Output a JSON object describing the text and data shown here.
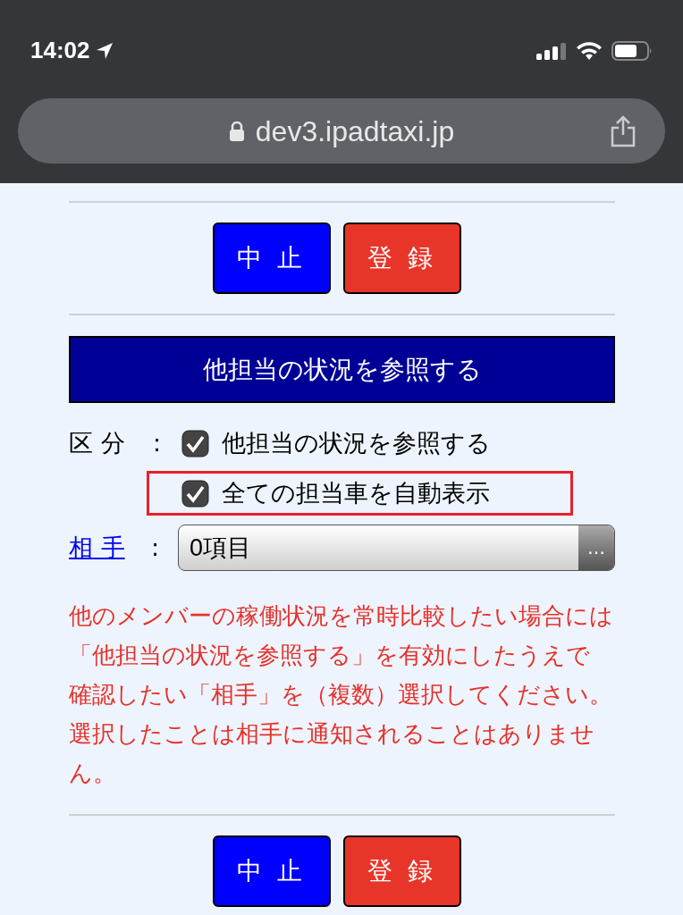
{
  "status_bar": {
    "time": "14:02"
  },
  "browser": {
    "url": "dev3.ipadtaxi.jp"
  },
  "top_buttons": [
    {
      "kind": "cancel",
      "label": "中 止"
    },
    {
      "kind": "register",
      "label": "登 録"
    }
  ],
  "section": {
    "title": "他担当の状況を参照する"
  },
  "category": {
    "label": "区 分",
    "colon": ":",
    "options": [
      {
        "label": "他担当の状況を参照する",
        "checked": true,
        "highlighted": false
      },
      {
        "label": "全ての担当車を自動表示",
        "checked": true,
        "highlighted": true
      }
    ]
  },
  "partner": {
    "label": "相 手",
    "colon": ":",
    "value": "0項目",
    "button": "…"
  },
  "notice": [
    "他のメンバーの稼働状況を常時比較したい場合には",
    "「他担当の状況を参照する」を有効にしたうえで",
    "確認したい「相手」を（複数）選択してください。",
    "選択したことは相手に通知されることはありませ",
    "ん。"
  ],
  "bottom_buttons": [
    {
      "kind": "cancel",
      "label": "中 止"
    },
    {
      "kind": "register",
      "label": "登 録"
    }
  ]
}
